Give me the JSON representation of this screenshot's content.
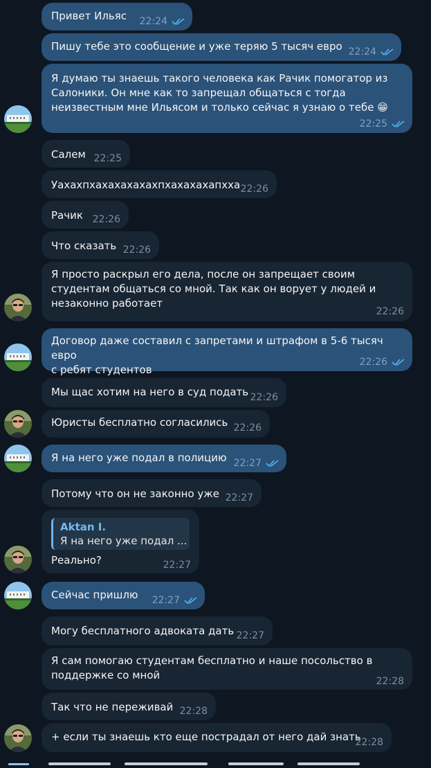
{
  "chat": {
    "messages": [
      {
        "text": "Привет Ильяс",
        "time": "22:24"
      },
      {
        "text": "Пишу тебе это сообщение и уже теряю 5 тысяч евро",
        "time": "22:24"
      },
      {
        "text": "Я думаю ты знаешь такого человека как Рачик помогатор из\nСалоники. Он мне как то запрещал общаться с тогда\nнеизвестным мне Ильясом и только сейчас я узнаю о тебе 😁",
        "time": "22:25"
      },
      {
        "text": "Салем",
        "time": "22:25"
      },
      {
        "text": "Уахахпхахахахахахпхахахахапхха",
        "time": "22:26"
      },
      {
        "text": "Рачик",
        "time": "22:26"
      },
      {
        "text": "Что сказать",
        "time": "22:26"
      },
      {
        "text": "Я просто раскрыл его дела, после он запрещает своим\nстудентам общаться со мной. Так как он ворует у людей и\nнезаконно работает",
        "time": "22:26"
      },
      {
        "text": "Договор даже составил с запретами и штрафом в 5-6 тысяч евро\nс ребят студентов",
        "time": "22:26"
      },
      {
        "text": "Мы щас хотим на него в суд подать",
        "time": "22:26"
      },
      {
        "text": "Юристы бесплатно согласились",
        "time": "22:26"
      },
      {
        "text": "Я на него уже подал в полицию",
        "time": "22:27"
      },
      {
        "text": "Потому что он не законно уже",
        "time": "22:27"
      },
      {
        "text": "Реально?",
        "time": "22:27",
        "reply_name": "Aktan I.",
        "reply_text": "Я на него уже подал ..."
      },
      {
        "text": "Сейчас пришлю",
        "time": "22:27"
      },
      {
        "text": "Могу бесплатного адвоката дать",
        "time": "22:27"
      },
      {
        "text": "Я сам помогаю студентам бесплатно и наше посольство в\nподдержке со мной",
        "time": "22:28"
      },
      {
        "text": "Так что не переживай",
        "time": "22:28"
      },
      {
        "text": "+ если ты знаешь кто еще пострадал от него дай знать",
        "time": "22:28"
      }
    ]
  },
  "colors": {
    "background": "#0e1621",
    "outgoing_bubble": "#2b5278",
    "incoming_bubble": "#182533",
    "read_ticks": "#4fb7f5",
    "reply_accent": "#6ab3f3"
  },
  "icons": [
    "double-check-icon",
    "avatar-building",
    "avatar-person"
  ]
}
